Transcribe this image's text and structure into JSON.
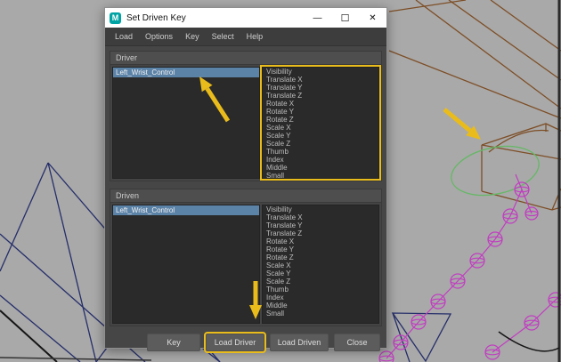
{
  "window": {
    "title": "Set Driven Key",
    "icon_letter": "M",
    "controls": {
      "minimize": "—",
      "maximize": "☐",
      "close": "✕"
    }
  },
  "menu": {
    "items": [
      "Load",
      "Options",
      "Key",
      "Select",
      "Help"
    ]
  },
  "driver": {
    "label": "Driver",
    "objects": [
      "Left_Wrist_Control"
    ],
    "attributes": [
      "Visibility",
      "Translate X",
      "Translate Y",
      "Translate Z",
      "Rotate X",
      "Rotate Y",
      "Rotate Z",
      "Scale X",
      "Scale Y",
      "Scale Z",
      "Thumb",
      "Index",
      "Middle",
      "Small"
    ]
  },
  "driven": {
    "label": "Driven",
    "objects": [
      "Left_Wrist_Control"
    ],
    "attributes": [
      "Visibility",
      "Translate X",
      "Translate Y",
      "Translate Z",
      "Rotate X",
      "Rotate Y",
      "Rotate Z",
      "Scale X",
      "Scale Y",
      "Scale Z",
      "Thumb",
      "Index",
      "Middle",
      "Small"
    ]
  },
  "buttons": {
    "key": "Key",
    "load_driver": "Load Driver",
    "load_driven": "Load Driven",
    "close": "Close"
  },
  "colors": {
    "selection_blue": "#5b82a7",
    "annotation_yellow": "#e9bc1c",
    "dialog_bg": "#464646",
    "list_bg": "#2a2a2a",
    "viewport_bg": "#a9a9a9",
    "wireframe_navy": "#252e6a",
    "wireframe_brown": "#7d4e26",
    "wireframe_magenta": "#c13ec1",
    "curve_green": "#66b766"
  }
}
